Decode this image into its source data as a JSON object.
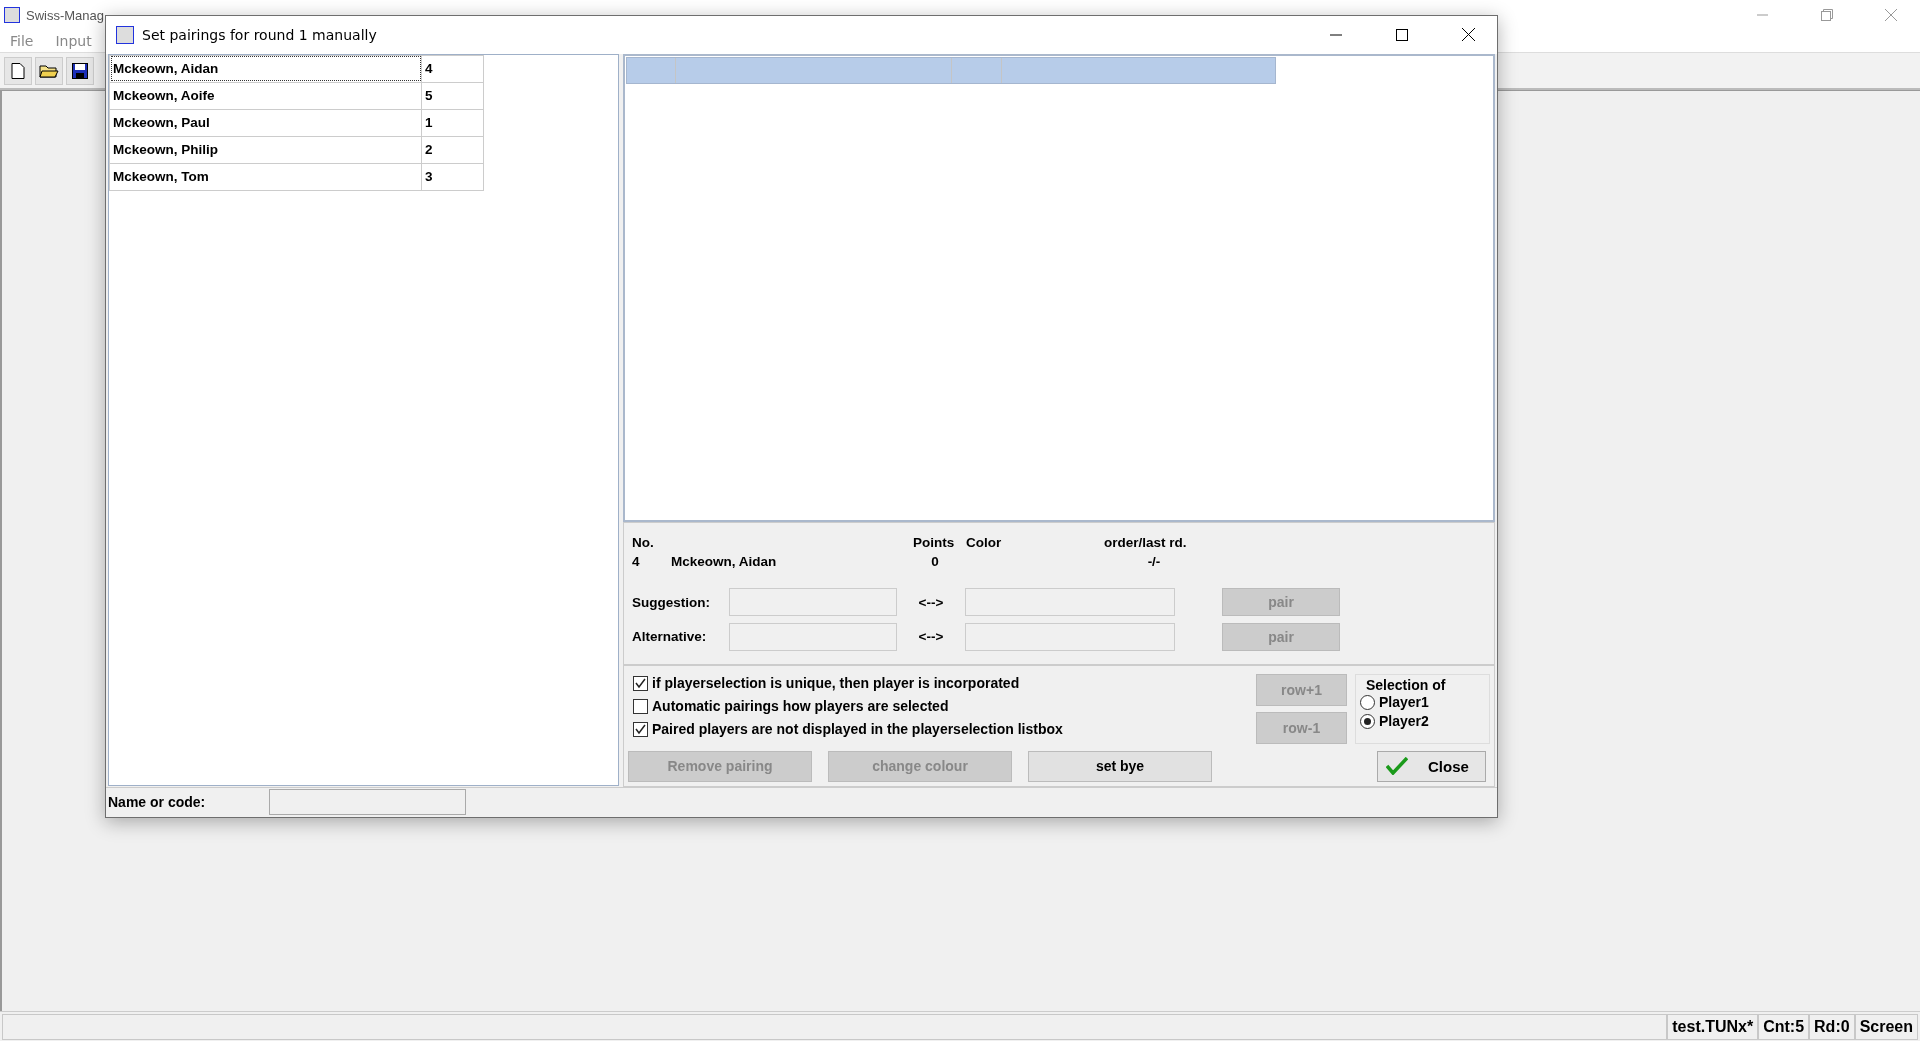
{
  "app": {
    "title": "Swiss-Manag",
    "menu": [
      "File",
      "Input"
    ]
  },
  "dialog": {
    "title": "Set pairings for round 1 manually",
    "players": [
      {
        "name": "Mckeown, Aidan",
        "number": "4",
        "selected": true
      },
      {
        "name": "Mckeown, Aoife",
        "number": "5",
        "selected": false
      },
      {
        "name": "Mckeown, Paul",
        "number": "1",
        "selected": false
      },
      {
        "name": "Mckeown, Philip",
        "number": "2",
        "selected": false
      },
      {
        "name": "Mckeown, Tom",
        "number": "3",
        "selected": false
      }
    ],
    "info": {
      "headers": [
        "No.",
        "Points",
        "Color",
        "order/last rd."
      ],
      "no": "4",
      "name": "Mckeown, Aidan",
      "points": "0",
      "order": "-/-"
    },
    "pair_rows": [
      {
        "label": "Suggestion:",
        "arrow": "<-->",
        "button": "pair",
        "disabled": true
      },
      {
        "label": "Alternative:",
        "arrow": "<-->",
        "button": "pair",
        "disabled": true
      }
    ],
    "options": [
      {
        "label": "if playerselection is unique, then player is incorporated",
        "checked": true
      },
      {
        "label": "Automatic pairings how players are selected",
        "checked": false
      },
      {
        "label": "Paired players are not displayed in the playerselection listbox",
        "checked": true
      }
    ],
    "row_buttons": [
      {
        "label": "row+1",
        "disabled": true
      },
      {
        "label": "row-1",
        "disabled": true
      }
    ],
    "selection": {
      "title": "Selection of",
      "options": [
        {
          "label": "Player1",
          "selected": false
        },
        {
          "label": "Player2",
          "selected": true
        }
      ]
    },
    "actions": [
      {
        "label": "Remove pairing",
        "disabled": true
      },
      {
        "label": "change colour",
        "disabled": true
      },
      {
        "label": "set bye",
        "disabled": false
      }
    ],
    "close_button": "Close",
    "search": {
      "label": "Name or code:"
    }
  },
  "status_bar": [
    "test.TUNx*",
    "Cnt:5",
    "Rd:0",
    "Screen"
  ]
}
